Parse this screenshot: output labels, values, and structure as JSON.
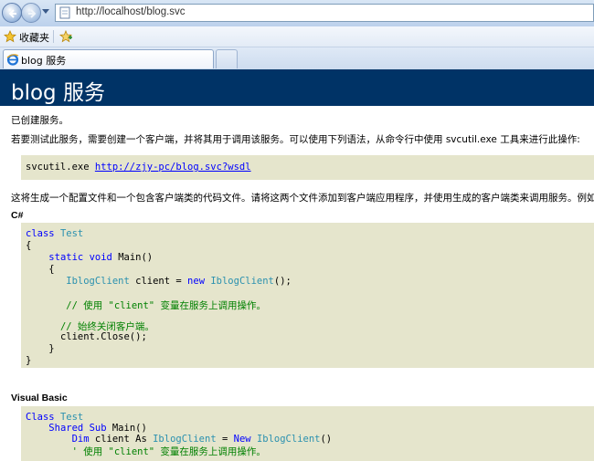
{
  "browser": {
    "address": "http://localhost/blog.svc",
    "favorites_label": "收藏夹",
    "tab_title": "blog 服务"
  },
  "page": {
    "title": "blog 服务",
    "created_msg": "已创建服务。",
    "instructions": "若要测试此服务，需要创建一个客户端，并将其用于调用该服务。可以使用下列语法，从命令行中使用  svcutil.exe 工具来进行此操作:",
    "svcutil": {
      "command": "svcutil.exe",
      "url": "http://zjy-pc/blog.svc?wsdl"
    },
    "generation_note": "这将生成一个配置文件和一个包含客户端类的代码文件。请将这两个文件添加到客户端应用程序，并使用生成的客户端类来调用服务。例如:",
    "csharp": {
      "label": "C#",
      "kw_class": "class",
      "class_name": "Test",
      "open_brace": "{",
      "close_brace": "}",
      "kw_static": "static",
      "kw_void": "void",
      "main_sig": "Main()",
      "client_type": "IblogClient",
      "client_decl": "client =",
      "kw_new": "new",
      "ctor_tail": "();",
      "comment_use": "// 使用 \"client\" 变量在服务上调用操作。",
      "comment_close": "// 始终关闭客户端。",
      "close_call": "client.Close();"
    },
    "vb": {
      "label": "Visual Basic",
      "kw_class": "Class",
      "class_name": "Test",
      "kw_shared": "Shared",
      "kw_sub": "Sub",
      "main_sig": "Main()",
      "kw_dim": "Dim",
      "client_as": "client As",
      "client_type": "IblogClient",
      "eq": "=",
      "kw_new": "New",
      "ctor_tail": "()",
      "comment_use": "' 使用 \"client\" 变量在服务上调用操作。"
    }
  }
}
